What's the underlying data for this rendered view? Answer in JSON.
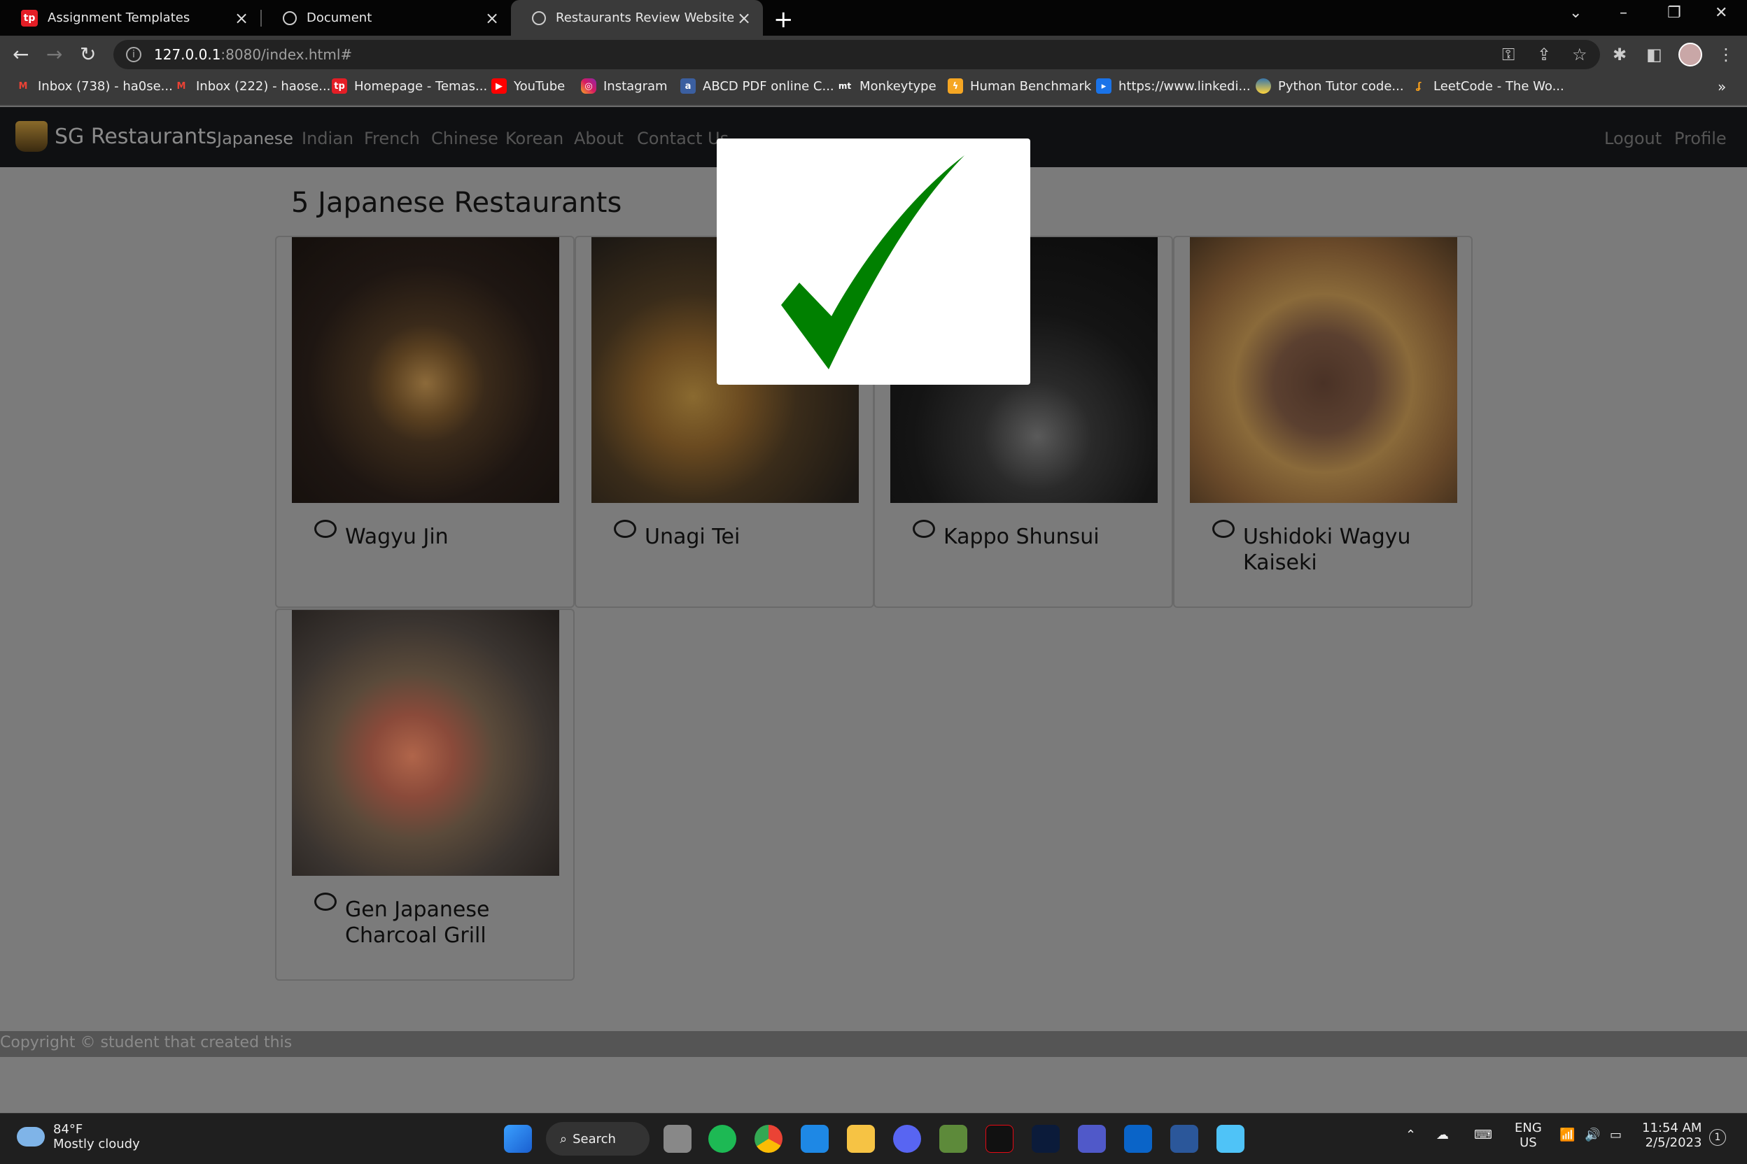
{
  "browser": {
    "tabs": [
      {
        "title": "Assignment Templates",
        "icon": "tp-icon"
      },
      {
        "title": "Document",
        "icon": "globe-icon"
      },
      {
        "title": "Restaurants Review Website",
        "icon": "globe-icon"
      }
    ],
    "url_host": "127.0.0.1",
    "url_rest": ":8080/index.html#",
    "bookmarks": [
      "Inbox (738) - ha0se...",
      "Inbox (222) - haose...",
      "Homepage - Temas...",
      "YouTube",
      "Instagram",
      "ABCD PDF online C...",
      "Monkeytype",
      "Human Benchmark",
      "https://www.linkedi...",
      "Python Tutor code...",
      "LeetCode - The Wo..."
    ],
    "bookmarks_more": "»"
  },
  "app": {
    "brand": "SG Restaurants",
    "nav": [
      "Japanese",
      "Indian",
      "French",
      "Chinese",
      "Korean",
      "About",
      "Contact Us"
    ],
    "nav_right": [
      "Logout",
      "Profile"
    ],
    "heading": "5 Japanese Restaurants",
    "restaurants": [
      {
        "name": "Wagyu Jin"
      },
      {
        "name": "Unagi Tei"
      },
      {
        "name": "Kappo Shunsui"
      },
      {
        "name": "Ushidoki Wagyu Kaiseki"
      },
      {
        "name": "Gen Japanese Charcoal Grill"
      }
    ],
    "footer": "Copyright © student that created this",
    "modal_icon": "checkmark-icon",
    "accent_check": "#008000"
  },
  "taskbar": {
    "weather_temp": "84°F",
    "weather_desc": "Mostly cloudy",
    "search": "Search",
    "lang1": "ENG",
    "lang2": "US",
    "time": "11:54 AM",
    "date": "2/5/2023",
    "notif": "1"
  }
}
